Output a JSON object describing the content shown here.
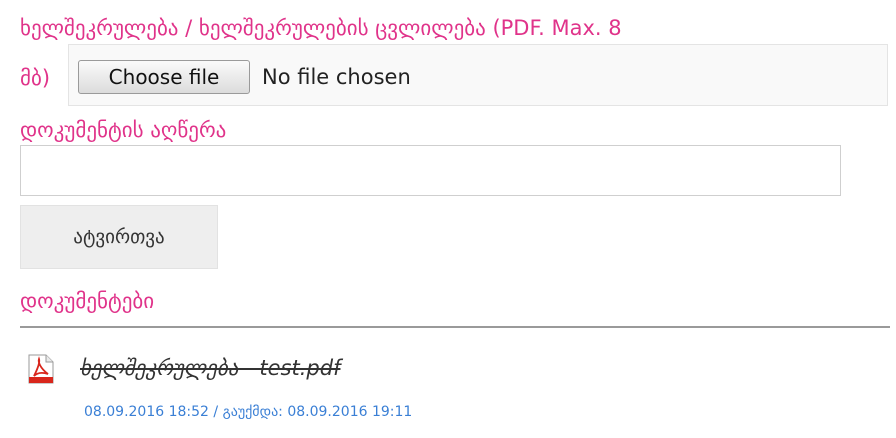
{
  "upload": {
    "label_line1": "ხელშეკრულება / ხელშეკრულების ცვლილება (PDF. Max. 8",
    "label_line2": "მბ)",
    "choose_button": "Choose file",
    "no_file_text": "No file chosen"
  },
  "description": {
    "label": "დოკუმენტის აღწერა",
    "value": "",
    "placeholder": ""
  },
  "submit": {
    "label": "ატვირთვა"
  },
  "documents": {
    "label": "დოკუმენტები",
    "items": [
      {
        "icon": "pdf-icon",
        "name": "ხელშეკრულება - test.pdf",
        "meta": "08.09.2016 18:52 / გაუქმდა: 08.09.2016 19:11"
      }
    ]
  },
  "colors": {
    "label": "#e0338a",
    "meta": "#3a7fd5",
    "pdf_red": "#d9261c"
  }
}
